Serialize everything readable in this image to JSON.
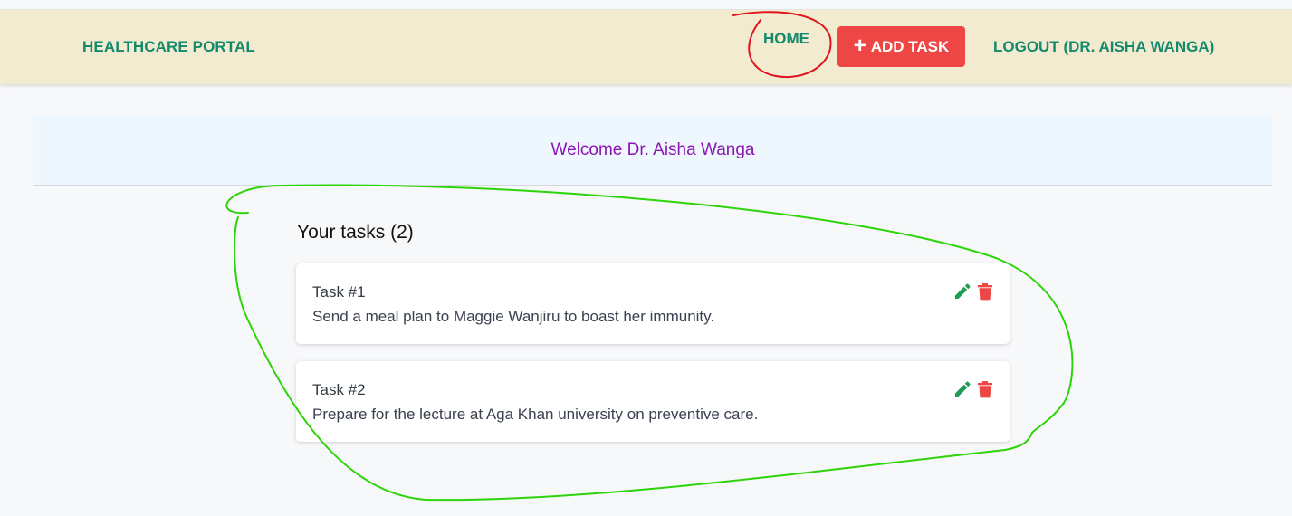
{
  "navbar": {
    "brand": "HEALTHCARE PORTAL",
    "home_label": "HOME",
    "add_task_label": "ADD TASK",
    "logout_label": "LOGOUT (DR. AISHA WANGA)"
  },
  "welcome": {
    "message": "Welcome Dr. Aisha Wanga"
  },
  "tasks": {
    "heading": "Your tasks (2)",
    "items": [
      {
        "name": "Task #1",
        "description": "Send a meal plan to Maggie Wanjiru to boast her immunity."
      },
      {
        "name": "Task #2",
        "description": "Prepare for the lecture at Aga Khan university on preventive care."
      }
    ]
  },
  "colors": {
    "navbar_bg": "#f3ebd0",
    "nav_text": "#128a6b",
    "add_button": "#ee4545",
    "welcome_text": "#8b17b3",
    "edit_icon": "#1f9d55",
    "delete_icon": "#ee4545",
    "annotation_red": "#e0141e",
    "annotation_green": "#2ed40a"
  },
  "icons": {
    "add": "plus-icon",
    "edit": "pencil-icon",
    "delete": "trash-icon"
  }
}
